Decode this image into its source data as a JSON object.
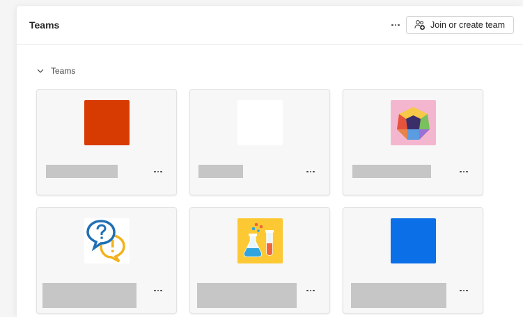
{
  "header": {
    "title": "Teams",
    "join_button_label": "Join or create team",
    "more_icon": "more-horizontal-icon",
    "join_icon": "people-add-icon"
  },
  "section": {
    "label": "Teams",
    "expanded": true,
    "toggle_icon": "chevron-down-icon"
  },
  "colors": {
    "card_background": "#f7f7f7",
    "redacted_name": "#c6c6c6",
    "team_orange": "#d83b01",
    "team_white": "#ffffff",
    "team_pink": "#f4b6cf",
    "team_yellow": "#fcc934",
    "team_blue": "#0b6fe8"
  },
  "teams": [
    {
      "avatar": "solid-orange-tile",
      "name_redacted": true
    },
    {
      "avatar": "solid-white-tile",
      "name_redacted": true
    },
    {
      "avatar": "colorful-dodecahedron-icon",
      "name_redacted": true
    },
    {
      "avatar": "question-exclamation-speech-bubbles-icon",
      "name_redacted": true
    },
    {
      "avatar": "science-flask-test-tube-icon",
      "name_redacted": true
    },
    {
      "avatar": "solid-blue-tile",
      "name_redacted": true
    }
  ]
}
